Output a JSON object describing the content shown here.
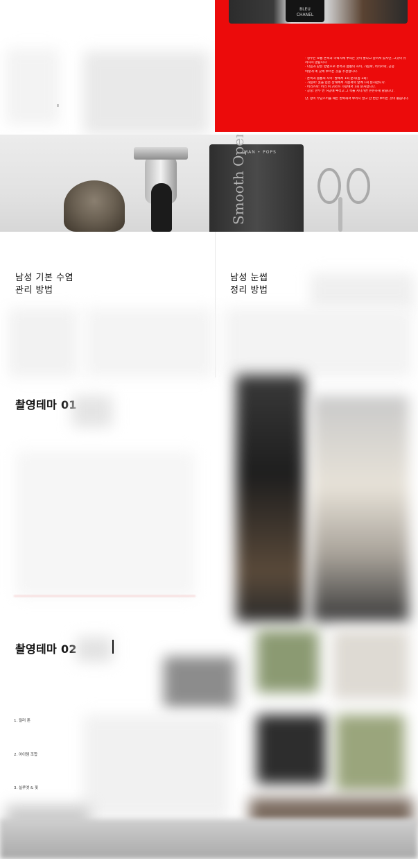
{
  "top": {
    "bottle_lines": [
      "BLEU",
      "CHANEL"
    ],
    "red_list": [
      "· 정수는 보통 손목과 허벅지에 뿌리는 것이 좋다고 알려져 있지만, 그것이 유",
      "  리하지 않습니다.",
      "· 다음과 같은 방법으로 손목과 몸통의 사이, 가슴팍, 머리카락, 공중",
      "  이렇게 네 곳에 뿌리는 것을 추천합니다.",
      "· 손목과 몸통의 사이: 팔에서 1회 분사(총 2회)",
      "· 가슴팍: 옷을 입은 상태에서 가슴팍의 앞에 1회 분사합니다.",
      "· 머리카락: 머리 위 20cm 가량에서 1회 분사합니다.",
      "· 공중: 한두 번 허공에 뿌리고 그 속을 지나가면 은은하게 남습니다.",
      "단, 향이 부담스러울 때는 반복해서 뿌리지 말고 한 번만 뿌리는 것이 좋습니다."
    ]
  },
  "tools": {
    "tube_brand": "MAN • POPS",
    "tube_text": "Smooth Operator"
  },
  "cards": [
    {
      "line1": "남성 기본 수염",
      "line2": "관리 방법"
    },
    {
      "line1": "남성 눈썹",
      "line2": "정리 방법"
    }
  ],
  "theme1": {
    "title": "촬영테마 01"
  },
  "theme2": {
    "title": "촬영테마 02",
    "items": [
      "1. 컬러 톤",
      "2. 아이템 조합",
      "3. 실루엣 & 핏"
    ]
  },
  "left_note": "ll",
  "colors": {
    "red": "#ec0b0b",
    "page": "#ffffff"
  }
}
